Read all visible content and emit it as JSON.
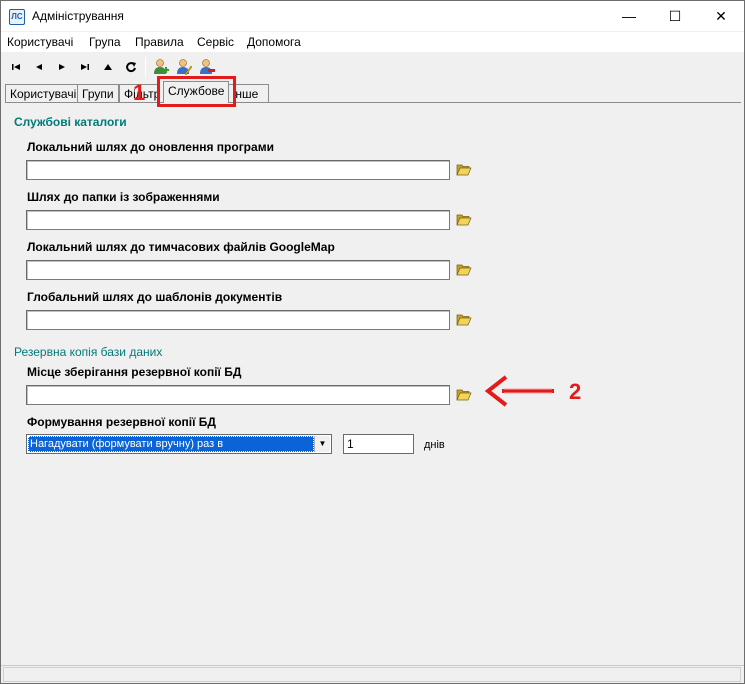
{
  "window": {
    "title": "Адміністрування",
    "icon_label": "ЛС",
    "controls": {
      "minimize": "—",
      "maximize": "☐",
      "close": "✕"
    }
  },
  "menu": [
    {
      "label": "Користувачі"
    },
    {
      "label": "Група"
    },
    {
      "label": "Правила"
    },
    {
      "label": "Сервіс"
    },
    {
      "label": "Допомога"
    }
  ],
  "toolbar": {
    "buttons": [
      {
        "icon": "first-record-icon",
        "glyph": "⏮"
      },
      {
        "icon": "prev-record-icon",
        "glyph": "◀"
      },
      {
        "icon": "next-record-icon",
        "glyph": "▶"
      },
      {
        "icon": "last-record-icon",
        "glyph": "⏭"
      },
      {
        "icon": "up-icon",
        "glyph": "▲"
      },
      {
        "icon": "refresh-icon",
        "glyph": "↻"
      }
    ],
    "user_buttons": [
      "add-user-icon",
      "edit-user-icon",
      "delete-user-icon"
    ]
  },
  "tabs": [
    {
      "label": "Користувачі"
    },
    {
      "label": "Групи"
    },
    {
      "label": "Фільтр"
    },
    {
      "label": "Службове",
      "active": true
    },
    {
      "label": "Інше"
    }
  ],
  "service": {
    "catalogs_title": "Службові каталоги",
    "fields": [
      {
        "label": "Локальний шлях до оновлення програми",
        "value": ""
      },
      {
        "label": "Шлях до папки із зображеннями",
        "value": ""
      },
      {
        "label": "Локальний шлях до тимчасових файлів GoogleMap",
        "value": ""
      },
      {
        "label": "Глобальний шлях до шаблонів документів",
        "value": ""
      }
    ],
    "backup_title": "Резервна копія бази даних",
    "backup_location_label": "Місце зберігання резервної копії БД",
    "backup_location_value": "",
    "backup_mode_label": "Формування резервної копії БД",
    "backup_mode_value": "Нагадувати (формувати вручну) раз в",
    "backup_interval_value": "1",
    "backup_interval_unit": "днів"
  },
  "annotations": {
    "marker_1": "1",
    "marker_2": "2",
    "color": "#e41b1b"
  },
  "colors": {
    "section_title": "#007a7a",
    "selection": "#0a64d8"
  }
}
